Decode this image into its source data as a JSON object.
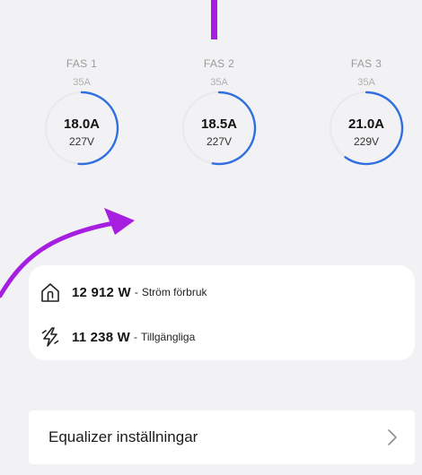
{
  "phases": [
    {
      "name": "FAS 1",
      "max": "35A",
      "current": "18.0A",
      "voltage": "227V",
      "fraction": 0.514
    },
    {
      "name": "FAS 2",
      "max": "35A",
      "current": "18.5A",
      "voltage": "227V",
      "fraction": 0.529
    },
    {
      "name": "FAS 3",
      "max": "35A",
      "current": "21.0A",
      "voltage": "229V",
      "fraction": 0.6
    }
  ],
  "power": {
    "consumption": {
      "value": "12 912 W",
      "separator": "-",
      "label": "Ström förbruk",
      "icon": "home-plug-icon"
    },
    "available": {
      "value": "11 238 W",
      "separator": "-",
      "label": "Tillgängliga",
      "icon": "lightning-icon"
    }
  },
  "equalizer": {
    "label": "Equalizer inställningar",
    "icon": "chevron-right-icon"
  },
  "colors": {
    "accent": "#2f6fe0",
    "track": "#e9e9ec",
    "annotation": "#a61ee0",
    "background": "#f2f2f4"
  }
}
